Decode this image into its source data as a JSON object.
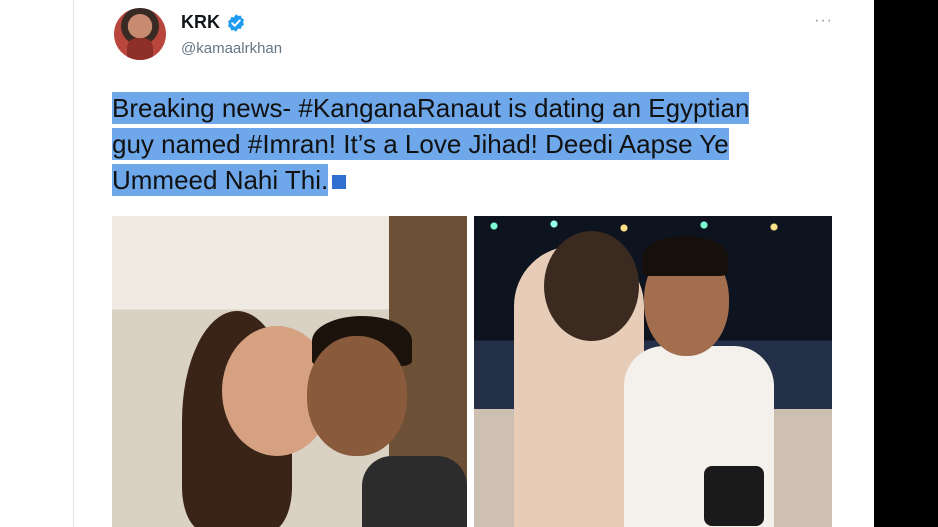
{
  "tweet": {
    "author": {
      "display_name": "KRK",
      "handle": "@kamaalrkhan",
      "verified": true,
      "avatar_icon": "profile-photo"
    },
    "more_label": "···",
    "text_lines": [
      "Breaking news- #KanganaRanaut is dating an Egyptian",
      "guy named #Imran! It’s a Love Jihad! Deedi Aapse Ye",
      "Ummeed Nahi Thi."
    ],
    "highlight_color": "#6ea8ea",
    "media_count": 2
  },
  "colors": {
    "verified_blue": "#1d9bf0",
    "handle_gray": "#657786",
    "right_bar": "#000000"
  }
}
